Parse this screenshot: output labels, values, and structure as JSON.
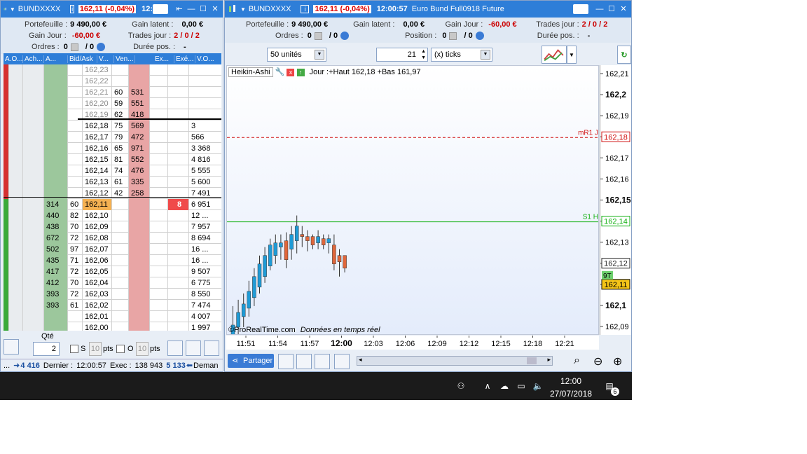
{
  "left_window": {
    "title_symbol": "BUNDXXXX",
    "title_price": "162,11 (-0,04%)",
    "title_time": "12:",
    "portefeuille_label": "Portefeuille :",
    "portefeuille_value": "9 490,00 €",
    "gain_latent_label": "Gain latent :",
    "gain_latent_value": "0,00 €",
    "gain_jour_label": "Gain Jour :",
    "gain_jour_value": "-60,00 €",
    "trades_jour_label": "Trades jour :",
    "trades_jour_value": "2 / 0 / 2",
    "ordres_label": "Ordres :",
    "ordres_value_a": "0",
    "ordres_value_b": "/ 0",
    "duree_label": "Durée pos. :",
    "duree_value": "-",
    "columns": [
      "A.O...",
      "Ach...",
      "A...",
      "Bid/Ask",
      "V...",
      "Ven...",
      "",
      "Ex...",
      "Exé...",
      "V.O..."
    ],
    "rows": [
      {
        "ach": "",
        "a": "",
        "price": "162,23",
        "v": "",
        "ven": "",
        "ex": "",
        "exe": "",
        "gray": true
      },
      {
        "ach": "",
        "a": "",
        "price": "162,22",
        "v": "",
        "ven": "",
        "ex": "",
        "exe": "",
        "gray": true
      },
      {
        "ach": "",
        "a": "",
        "price": "162,21",
        "v": "60",
        "ven": "531",
        "ex": "",
        "exe": "",
        "gray": true
      },
      {
        "ach": "",
        "a": "",
        "price": "162,20",
        "v": "59",
        "ven": "551",
        "ex": "",
        "exe": "",
        "gray": true
      },
      {
        "ach": "",
        "a": "",
        "price": "162,19",
        "v": "62",
        "ven": "418",
        "ex": "",
        "exe": "",
        "gray": true
      },
      {
        "ach": "",
        "a": "",
        "price": "162,18",
        "v": "75",
        "ven": "569",
        "ex": "",
        "exe": "3",
        "gray": false
      },
      {
        "ach": "",
        "a": "",
        "price": "162,17",
        "v": "79",
        "ven": "472",
        "ex": "",
        "exe": "566",
        "gray": false
      },
      {
        "ach": "",
        "a": "",
        "price": "162,16",
        "v": "65",
        "ven": "971",
        "ex": "",
        "exe": "3 368",
        "gray": false
      },
      {
        "ach": "",
        "a": "",
        "price": "162,15",
        "v": "81",
        "ven": "552",
        "ex": "",
        "exe": "4 816",
        "gray": false
      },
      {
        "ach": "",
        "a": "",
        "price": "162,14",
        "v": "74",
        "ven": "476",
        "ex": "",
        "exe": "5 555",
        "gray": false
      },
      {
        "ach": "",
        "a": "",
        "price": "162,13",
        "v": "61",
        "ven": "335",
        "ex": "",
        "exe": "5 600",
        "gray": false
      },
      {
        "ach": "",
        "a": "",
        "price": "162,12",
        "v": "42",
        "ven": "258",
        "ex": "",
        "exe": "7 491",
        "gray": false
      },
      {
        "ach": "314",
        "a": "60",
        "price": "162,11",
        "v": "",
        "ven": "",
        "ex": "8",
        "exe": "6 951",
        "gray": false,
        "current": true
      },
      {
        "ach": "440",
        "a": "82",
        "price": "162,10",
        "v": "",
        "ven": "",
        "ex": "",
        "exe": "12 ...",
        "gray": false
      },
      {
        "ach": "438",
        "a": "70",
        "price": "162,09",
        "v": "",
        "ven": "",
        "ex": "",
        "exe": "7 957",
        "gray": false
      },
      {
        "ach": "672",
        "a": "72",
        "price": "162,08",
        "v": "",
        "ven": "",
        "ex": "",
        "exe": "8 694",
        "gray": false
      },
      {
        "ach": "502",
        "a": "97",
        "price": "162,07",
        "v": "",
        "ven": "",
        "ex": "",
        "exe": "16 ...",
        "gray": false
      },
      {
        "ach": "435",
        "a": "71",
        "price": "162,06",
        "v": "",
        "ven": "",
        "ex": "",
        "exe": "16 ...",
        "gray": false
      },
      {
        "ach": "417",
        "a": "72",
        "price": "162,05",
        "v": "",
        "ven": "",
        "ex": "",
        "exe": "9 507",
        "gray": false
      },
      {
        "ach": "412",
        "a": "70",
        "price": "162,04",
        "v": "",
        "ven": "",
        "ex": "",
        "exe": "6 775",
        "gray": false
      },
      {
        "ach": "393",
        "a": "72",
        "price": "162,03",
        "v": "",
        "ven": "",
        "ex": "",
        "exe": "8 550",
        "gray": false
      },
      {
        "ach": "393",
        "a": "61",
        "price": "162,02",
        "v": "",
        "ven": "",
        "ex": "",
        "exe": "7 474",
        "gray": false
      },
      {
        "ach": "",
        "a": "",
        "price": "162,01",
        "v": "",
        "ven": "",
        "ex": "",
        "exe": "4 007",
        "gray": false
      },
      {
        "ach": "",
        "a": "",
        "price": "162,00",
        "v": "",
        "ven": "",
        "ex": "",
        "exe": "1 997",
        "gray": false
      }
    ],
    "qty_label": "Qté",
    "qty_value": "2",
    "s_label": "S",
    "o_label": "O",
    "pts_value": "10",
    "pts_label": "pts",
    "status_a": "4 416",
    "status_dernier_label": "Dernier :",
    "status_dernier_value": "12:00:57",
    "status_exec_label": "Exec :",
    "status_exec_value": "138 943",
    "status_b": "5 133",
    "status_deman": "Deman"
  },
  "right_window": {
    "title_symbol": "BUNDXXXX",
    "title_price": "162,11 (-0,04%)",
    "title_time": "12:00:57",
    "title_instrument": "Euro Bund Full0918 Future",
    "portefeuille_label": "Portefeuille :",
    "portefeuille_value": "9 490,00 €",
    "gain_latent_label": "Gain latent :",
    "gain_latent_value": "0,00 €",
    "gain_jour_label": "Gain Jour :",
    "gain_jour_value": "-60,00 €",
    "trades_jour_label": "Trades jour :",
    "trades_jour_value": "2 / 0 / 2",
    "ordres_label": "Ordres :",
    "ordres_value_a": "0",
    "ordres_value_b": "/ 0",
    "position_label": "Position :",
    "position_value_a": "0",
    "position_value_b": "/ 0",
    "duree_label": "Durée pos. :",
    "duree_value": "-",
    "units_select": "50 unités",
    "ticks_value": "21",
    "ticks_select": "(x) ticks",
    "chart_type_label": "Heikin-Ashi",
    "chart_header_info": "Jour :+Haut 162,18 +Bas 161,97",
    "watermark_a": "©ProRealTime.com",
    "watermark_b": "Données en temps réel",
    "share_label": "Partager"
  },
  "chart_data": {
    "type": "candlestick",
    "y_ticks": [
      "162,21",
      "162,2",
      "162,19",
      "162,18",
      "162,17",
      "162,16",
      "162,15",
      "162,14",
      "162,13",
      "162,12",
      "162,11",
      "162,1",
      "162,09"
    ],
    "y_ticks_bold": [
      "162,2",
      "162,15",
      "162,1"
    ],
    "x_ticks": [
      "11:51",
      "11:54",
      "11:57",
      "12:00",
      "12:03",
      "12:06",
      "12:09",
      "12:12",
      "12:15",
      "12:18",
      "12:21"
    ],
    "x_ticks_bold": [
      "12:00"
    ],
    "ylim": [
      162.086,
      162.214
    ],
    "lines": [
      {
        "name": "mR1 J",
        "value": 162.18,
        "label": "162,18",
        "color": "#d01010",
        "style": "dashed"
      },
      {
        "name": "S1 H",
        "value": 162.14,
        "label": "162,14",
        "color": "#10b010",
        "style": "solid"
      }
    ],
    "current_price_label": "162,11",
    "current_price_value": 162.11,
    "other_label": "162,12",
    "other_label_value": 162.12,
    "nine_t_label": "9T",
    "candles": [
      {
        "o": 162.086,
        "h": 162.1,
        "l": 162.086,
        "c": 162.091,
        "up": true
      },
      {
        "o": 162.09,
        "h": 162.103,
        "l": 162.085,
        "c": 162.097,
        "up": true
      },
      {
        "o": 162.095,
        "h": 162.106,
        "l": 162.09,
        "c": 162.101,
        "up": true
      },
      {
        "o": 162.099,
        "h": 162.112,
        "l": 162.095,
        "c": 162.107,
        "up": true
      },
      {
        "o": 162.104,
        "h": 162.118,
        "l": 162.1,
        "c": 162.114,
        "up": true
      },
      {
        "o": 162.109,
        "h": 162.124,
        "l": 162.106,
        "c": 162.12,
        "up": true
      },
      {
        "o": 162.114,
        "h": 162.128,
        "l": 162.111,
        "c": 162.124,
        "up": true
      },
      {
        "o": 162.119,
        "h": 162.132,
        "l": 162.117,
        "c": 162.129,
        "up": true
      },
      {
        "o": 162.124,
        "h": 162.134,
        "l": 162.12,
        "c": 162.13,
        "up": true
      },
      {
        "o": 162.128,
        "h": 162.134,
        "l": 162.122,
        "c": 162.13,
        "up": true
      },
      {
        "o": 162.131,
        "h": 162.135,
        "l": 162.118,
        "c": 162.122,
        "up": false
      },
      {
        "o": 162.127,
        "h": 162.138,
        "l": 162.122,
        "c": 162.134,
        "up": true
      },
      {
        "o": 162.131,
        "h": 162.143,
        "l": 162.125,
        "c": 162.138,
        "up": true
      },
      {
        "o": 162.134,
        "h": 162.138,
        "l": 162.128,
        "c": 162.133,
        "up": false
      },
      {
        "o": 162.133,
        "h": 162.136,
        "l": 162.126,
        "c": 162.131,
        "up": false
      },
      {
        "o": 162.133,
        "h": 162.134,
        "l": 162.127,
        "c": 162.129,
        "up": false
      },
      {
        "o": 162.13,
        "h": 162.136,
        "l": 162.127,
        "c": 162.133,
        "up": true
      },
      {
        "o": 162.132,
        "h": 162.134,
        "l": 162.127,
        "c": 162.129,
        "up": false
      },
      {
        "o": 162.13,
        "h": 162.134,
        "l": 162.125,
        "c": 162.132,
        "up": true
      },
      {
        "o": 162.129,
        "h": 162.134,
        "l": 162.117,
        "c": 162.12,
        "up": false
      },
      {
        "o": 162.124,
        "h": 162.127,
        "l": 162.114,
        "c": 162.121,
        "up": false
      },
      {
        "o": 162.124,
        "h": 162.124,
        "l": 162.116,
        "c": 162.118,
        "up": false
      }
    ]
  },
  "taskbar": {
    "time": "12:00",
    "date": "27/07/2018",
    "notif_count": "6"
  },
  "colors": {
    "title_bar": "#2e7ed8",
    "up_candle": "#1f9bd6",
    "down_candle": "#e0663a",
    "buy_column": "#9cc79c",
    "sell_column": "#e8a5a5"
  }
}
